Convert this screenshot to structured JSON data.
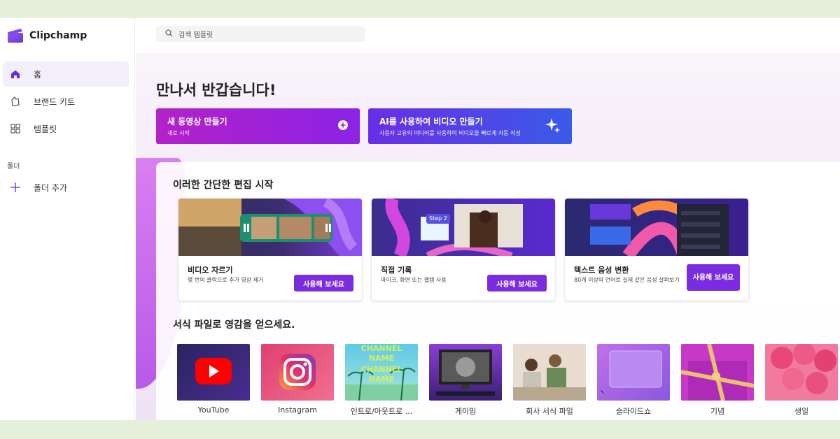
{
  "app": {
    "name": "Clipchamp"
  },
  "sidebar": {
    "items": [
      {
        "label": "홈",
        "icon": "home-icon",
        "active": true
      },
      {
        "label": "브랜드 키트",
        "icon": "brand-kit-icon",
        "active": false
      },
      {
        "label": "템플릿",
        "icon": "templates-icon",
        "active": false
      }
    ],
    "section_label": "폴더",
    "add_folder_label": "폴더 추가"
  },
  "search": {
    "placeholder": "검색 템플릿"
  },
  "welcome": "만나서 반갑습니다!",
  "cta": {
    "new_video": {
      "title": "새 동영상 만들기",
      "subtitle": "새로 시작"
    },
    "ai_video": {
      "title": "AI를 사용하여 비디오 만들기",
      "subtitle": "사용자 고유의 미디어를 사용하여 비디오을 빠르게 자동 작성"
    }
  },
  "quick_start": {
    "title": "이러한 간단한 편집 시작",
    "cards": [
      {
        "title": "비디오 자르기",
        "desc": "몇 번의 클릭으로 추가 영상 제거",
        "button": "사용해 보세요"
      },
      {
        "title": "직접 기록",
        "desc": "마이크, 화면 또는 웹캠 사용",
        "button": "사용해 보세요",
        "thumb_label": "Step 2"
      },
      {
        "title": "텍스트 음성 변환",
        "desc": "80개 이상의 언어로 실제 같은 음성 살펴보기",
        "button": "사용해 보세요"
      }
    ]
  },
  "inspiration": {
    "title": "서식 파일로 영감을 얻으세요.",
    "templates": [
      {
        "label": "YouTube"
      },
      {
        "label": "Instagram"
      },
      {
        "label": "인트로/아웃트로 ...",
        "thumb_text": [
          "CHANNEL",
          "NAME",
          "CHANNEL",
          "NAME"
        ]
      },
      {
        "label": "게이밍"
      },
      {
        "label": "회사 서식 파일"
      },
      {
        "label": "슬라이드쇼"
      },
      {
        "label": "기념"
      },
      {
        "label": "생일"
      }
    ]
  },
  "colors": {
    "accent": "#7b2be0",
    "cta_left": "#b321c9",
    "cta_right": "#3a5ae8",
    "page_bg": "#e4f0dc"
  }
}
